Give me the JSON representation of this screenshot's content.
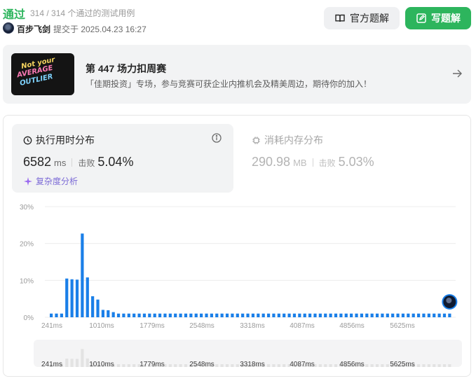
{
  "header": {
    "status": "通过",
    "testcases": "314 / 314 个通过的测试用例",
    "username": "百步飞剑",
    "submitted": "提交于 2025.04.23 16:27",
    "official_solution_label": "官方题解",
    "write_solution_label": "写题解"
  },
  "banner": {
    "image_text": [
      "Not your",
      "AVERAGE",
      "OUTLIER"
    ],
    "title": "第 447 场力扣周赛",
    "description": "「佳期投资」专场，参与竞赛可获企业内推机会及精美周边，期待你的加入！"
  },
  "runtime": {
    "title": "执行用时分布",
    "value": "6582",
    "unit": "ms",
    "beat_label": "击败",
    "beat": "5.04%",
    "analysis_label": "复杂度分析"
  },
  "memory": {
    "title": "消耗内存分布",
    "value": "290.98",
    "unit": "MB",
    "beat_label": "击败",
    "beat": "5.03%"
  },
  "colors": {
    "accent_green": "#2db55d",
    "bar_blue": "#1a7fe8",
    "minimap_bar": "#e3e3e3"
  },
  "chart_data": {
    "type": "bar",
    "title": "",
    "xlabel": "",
    "ylabel": "",
    "ylim": [
      0,
      30
    ],
    "y_ticks": [
      "30%",
      "20%",
      "10%",
      "0%"
    ],
    "x_ticks": [
      "241ms",
      "1010ms",
      "1779ms",
      "2548ms",
      "3318ms",
      "4087ms",
      "4856ms",
      "5625ms"
    ],
    "values": [
      1,
      1,
      1,
      10.5,
      10.3,
      10.2,
      22.7,
      10.8,
      5.7,
      4.8,
      2,
      1.9,
      1.4,
      1,
      1,
      1,
      1,
      1,
      1,
      1,
      1,
      1,
      1,
      1,
      1,
      1,
      1,
      1,
      1,
      1,
      1,
      1,
      1,
      1,
      1,
      1,
      1,
      1,
      1,
      1,
      1,
      1,
      1,
      1,
      1,
      1,
      1,
      1,
      1,
      1,
      1,
      1,
      1,
      1,
      1,
      1,
      1,
      1,
      1,
      1,
      1,
      1,
      1,
      1,
      1,
      1,
      1,
      1,
      1,
      1,
      1,
      1,
      1,
      1,
      1,
      1,
      1,
      1
    ],
    "user_marker_position": "right end",
    "grid": true
  }
}
